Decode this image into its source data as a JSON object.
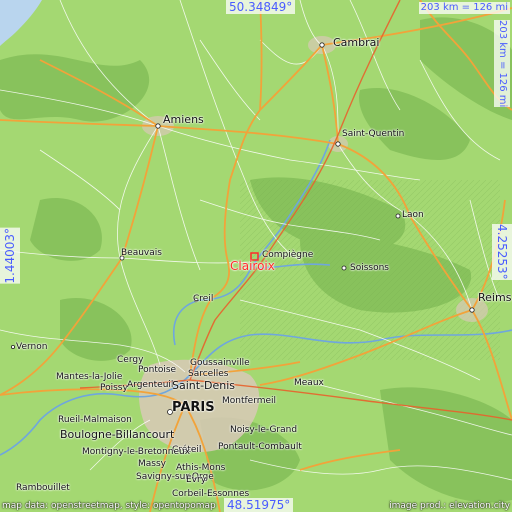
{
  "coords": {
    "north": "50.34849°",
    "south": "48.51975°",
    "west": "1.44003°",
    "east": "4.25253°"
  },
  "scale": {
    "horizontal": "203 km = 126 mi",
    "vertical": "203 km = 126 mi"
  },
  "credits": {
    "left": "map data: openstreetmap, style: opentopomap",
    "right": "image prod.: elevation.city"
  },
  "place": {
    "name": "Clairoix",
    "marker_color": "#ff2a2a"
  },
  "cities": {
    "cambrai": "Cambrai",
    "amiens": "Amiens",
    "saint_quentin": "Saint-Quentin",
    "laon": "Laon",
    "compiegne": "Compiègne",
    "soissons": "Soissons",
    "beauvais": "Beauvais",
    "reims": "Reims",
    "creil": "Creil",
    "vernon": "Vernon",
    "cergy": "Cergy",
    "goussainville": "Goussainville",
    "pontoise": "Pontoise",
    "sarcelles": "Sarcelles",
    "mantes": "Mantes-la-Jolie",
    "poissy": "Poissy",
    "argenteuil": "Argenteuil",
    "saint_denis": "Saint-Denis",
    "montfermeil": "Montfermeil",
    "meaux": "Meaux",
    "paris": "PARIS",
    "rueil": "Rueil-Malmaison",
    "boulogne": "Boulogne-Billancourt",
    "noisy": "Noisy-le-Grand",
    "creteil": "Créteil",
    "montigny": "Montigny-le-Bretonneux",
    "massy": "Massy",
    "athis": "Athis-Mons",
    "savigny": "Savigny-sur-Orge",
    "pontault": "Pontault-Combault",
    "rambouillet": "Rambouillet",
    "evry": "Évry",
    "corbeil": "Corbeil-Essonnes"
  },
  "colors": {
    "land_low": "#a4d872",
    "land_mid": "#86c25a",
    "sea": "#b9d5ee",
    "roads_major": "#f2a33a",
    "roads_minor": "#ffffff",
    "water": "#6fa6de",
    "label_accent": "#4a5cff"
  }
}
